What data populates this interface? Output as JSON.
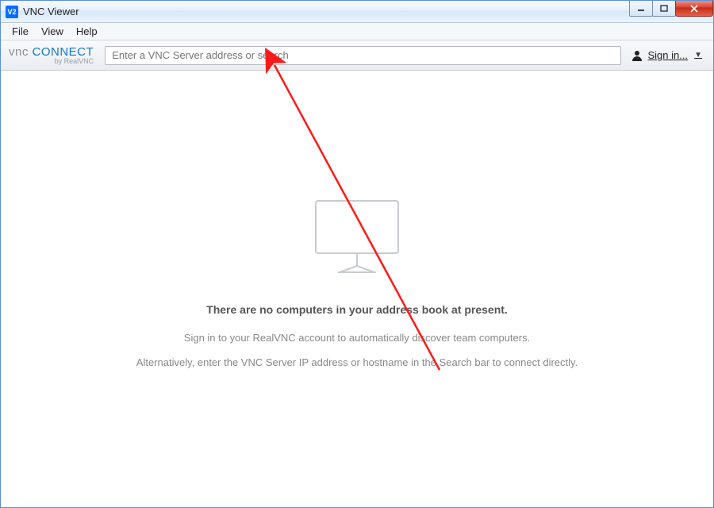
{
  "window": {
    "title": "VNC Viewer"
  },
  "menu": {
    "items": [
      "File",
      "View",
      "Help"
    ]
  },
  "toolbar": {
    "logo": {
      "part1": "vnc",
      "part2": " CONNECT",
      "sub": "by RealVNC"
    },
    "address_placeholder": "Enter a VNC Server address or search",
    "signin_label": "Sign in..."
  },
  "empty_state": {
    "heading": "There are no computers in your address book at present.",
    "line1": "Sign in to your RealVNC account to automatically discover team computers.",
    "line2": "Alternatively, enter the VNC Server IP address or hostname in the Search bar to connect directly."
  }
}
